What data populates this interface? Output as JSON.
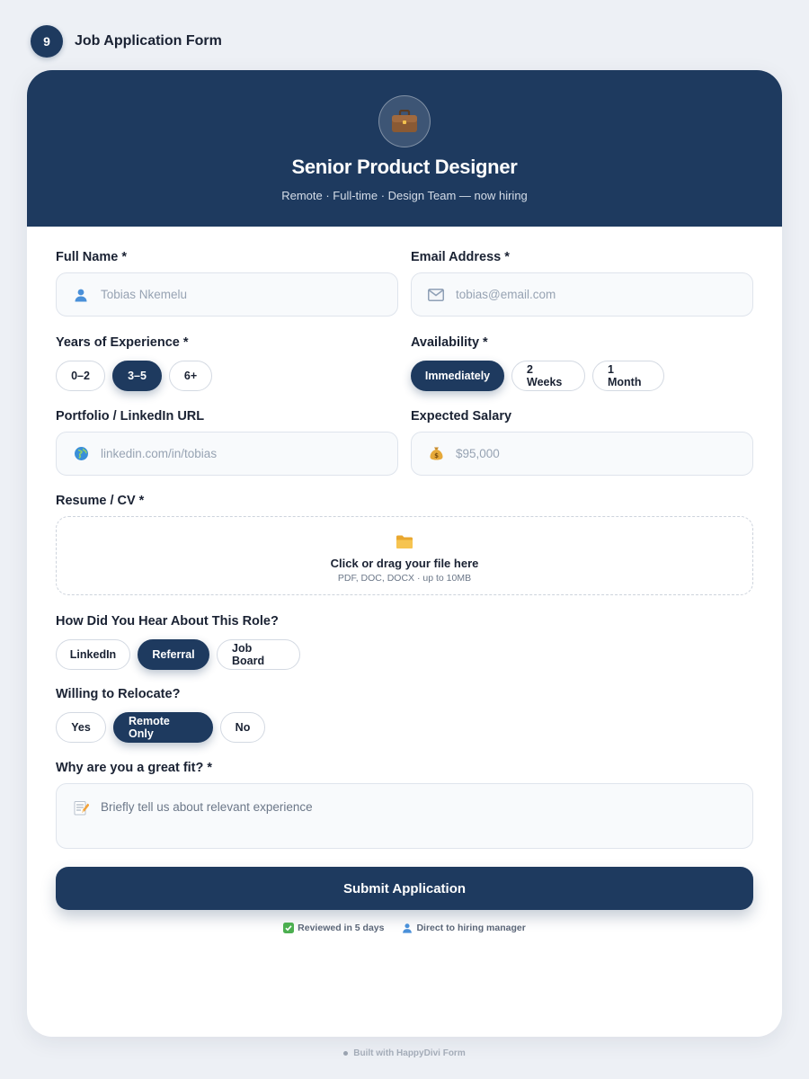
{
  "step": {
    "number": "9",
    "title": "Job Application Form"
  },
  "hero": {
    "icon": "briefcase-icon",
    "title": "Senior Product Designer",
    "subtitle": "Remote · Full-time · Design Team — now hiring"
  },
  "fields": {
    "full_name": {
      "label": "Full Name *",
      "icon": "person-icon",
      "placeholder": "Tobias Nkemelu"
    },
    "email": {
      "label": "Email Address *",
      "icon": "envelope-icon",
      "placeholder": "tobias@email.com"
    },
    "experience": {
      "label": "Years of Experience *",
      "options": [
        "0–2",
        "3–5",
        "6+"
      ],
      "selected": "3–5"
    },
    "availability": {
      "label": "Availability *",
      "options": [
        "Immediately",
        "2 Weeks",
        "1 Month"
      ],
      "selected": "Immediately"
    },
    "portfolio": {
      "label": "Portfolio / LinkedIn URL",
      "icon": "globe-icon",
      "placeholder": "linkedin.com/in/tobias"
    },
    "salary": {
      "label": "Expected Salary",
      "icon": "money-bag-icon",
      "placeholder": "$95,000"
    },
    "resume": {
      "label": "Resume / CV *",
      "icon": "folder-icon",
      "title": "Click or drag your file here",
      "hint": "PDF, DOC, DOCX · up to 10MB"
    },
    "source": {
      "label": "How Did You Hear About This Role?",
      "options": [
        "LinkedIn",
        "Referral",
        "Job Board"
      ],
      "selected": "Referral"
    },
    "relocate": {
      "label": "Willing to Relocate?",
      "options": [
        "Yes",
        "Remote Only",
        "No"
      ],
      "selected": "Remote Only"
    },
    "fit": {
      "label": "Why are you a great fit? *",
      "icon": "memo-icon",
      "placeholder": "Briefly tell us about relevant experience"
    }
  },
  "submit": {
    "label": "Submit Application"
  },
  "trust": [
    {
      "icon": "check-icon",
      "text": "Reviewed in 5 days"
    },
    {
      "icon": "person-icon",
      "text": "Direct to hiring manager"
    }
  ],
  "footer": {
    "text": "Built with HappyDivi Form"
  },
  "colors": {
    "primary": "#1e3a5f",
    "background": "#edf0f5",
    "field_bg": "#f8fafc",
    "field_border": "#dfe4ec"
  }
}
